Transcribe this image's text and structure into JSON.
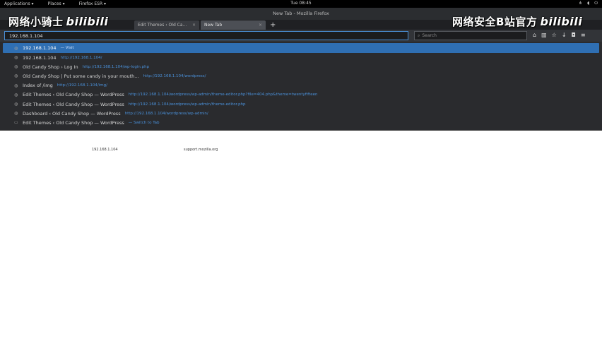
{
  "topbar": {
    "applications": "Applications ▾",
    "places": "Places ▾",
    "app": "Firefox ESR ▾",
    "clock": "Tue 08:45"
  },
  "window": {
    "title": "New Tab - Mozilla Firefox"
  },
  "tabs": [
    {
      "label": "Edit Themes ‹ Old Ca...",
      "close": "×"
    },
    {
      "label": "New Tab",
      "close": "×"
    }
  ],
  "newtab_label": "+",
  "urlbar": {
    "value": "192.168.1.104"
  },
  "searchbar": {
    "placeholder": "Search"
  },
  "dropdown": [
    {
      "title": "192.168.1.104",
      "url": "— Visit",
      "icon": "globe-icon"
    },
    {
      "title": "192.168.1.104",
      "url": "http://192.168.1.104/",
      "icon": "globe-icon"
    },
    {
      "title": "Old Candy Shop › Log In",
      "url": "http://192.168.1.104/wp-login.php",
      "icon": "globe-icon"
    },
    {
      "title": "Old Candy Shop | Put some candy in your mouth...",
      "url": "http://192.168.1.104/wordpress/",
      "icon": "globe-icon"
    },
    {
      "title": "Index of /img",
      "url": "http://192.168.1.104/img/",
      "icon": "globe-icon"
    },
    {
      "title": "Edit Themes ‹ Old Candy Shop — WordPress",
      "url": "http://192.168.1.104/wordpress/wp-admin/theme-editor.php?file=404.php&theme=twentyfifteen",
      "icon": "globe-icon"
    },
    {
      "title": "Edit Themes ‹ Old Candy Shop — WordPress",
      "url": "http://192.168.1.104/wordpress/wp-admin/theme-editor.php",
      "icon": "globe-icon"
    },
    {
      "title": "Dashboard ‹ Old Candy Shop — WordPress",
      "url": "http://192.168.1.104/wordpress/wp-admin/",
      "icon": "globe-icon"
    },
    {
      "title": "Edit Themes ‹ Old Candy Shop — WordPress",
      "url": "— Switch to Tab",
      "icon": "tab-icon"
    }
  ],
  "page": {
    "left_text": "192.168.1.104",
    "right_text": "support.mozilla.org"
  },
  "watermark": {
    "left": "网络小骑士",
    "right": "网络安全B站官方",
    "logo": "bilibili"
  }
}
